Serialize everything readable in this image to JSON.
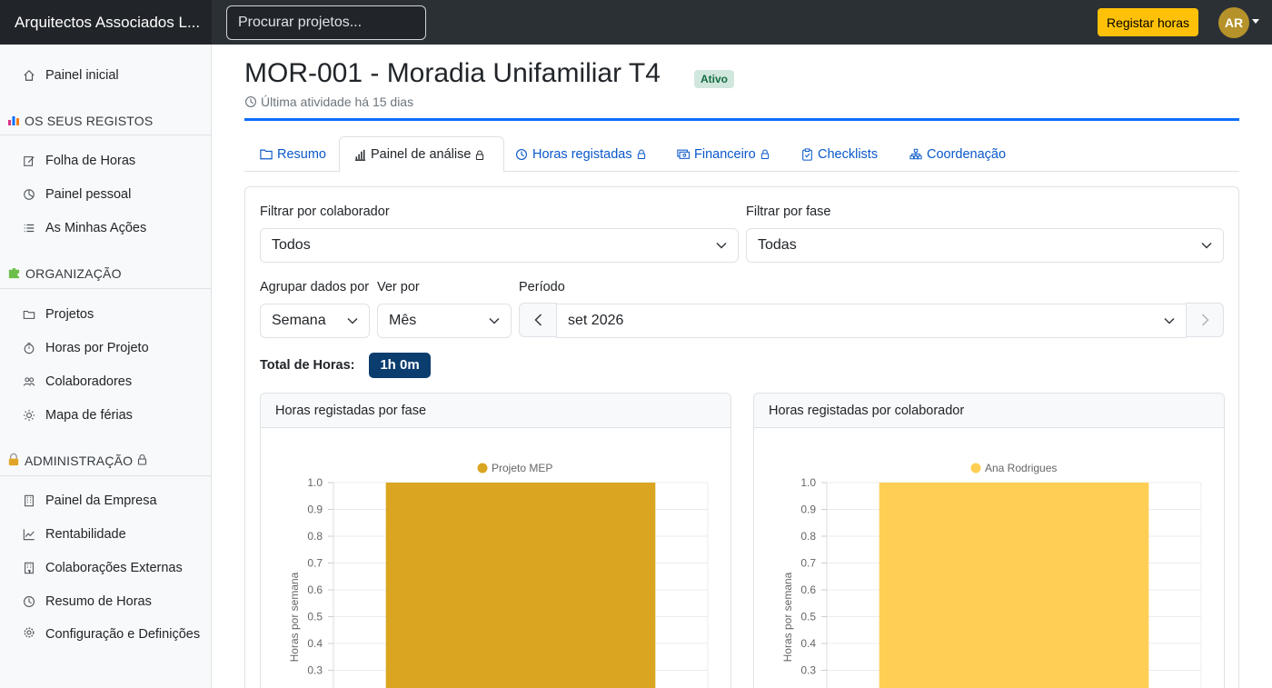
{
  "app": {
    "brand": "Arquitectos Associados L...",
    "search_placeholder": "Procurar projetos...",
    "register_hours_label": "Registar horas",
    "avatar_initials": "AR"
  },
  "sidebar": {
    "home": "Painel inicial",
    "section_records": "OS SEUS REGISTOS",
    "records": [
      "Folha de Horas",
      "Painel pessoal",
      "As Minhas Ações"
    ],
    "section_org": "ORGANIZAÇÃO",
    "org": [
      "Projetos",
      "Horas por Projeto",
      "Colaboradores",
      "Mapa de férias"
    ],
    "section_admin": "ADMINISTRAÇÃO",
    "admin": [
      "Painel da Empresa",
      "Rentabilidade",
      "Colaborações Externas",
      "Resumo de Horas",
      "Configuração e Definições"
    ]
  },
  "project": {
    "title": "MOR-001 - Moradia Unifamiliar T4",
    "status": "Ativo",
    "last_activity": "Última atividade há 15 dias"
  },
  "tabs": [
    "Resumo",
    "Painel de análise",
    "Horas registadas",
    "Financeiro",
    "Checklists",
    "Coordenação"
  ],
  "filters": {
    "collaborator_label": "Filtrar por colaborador",
    "collaborator_value": "Todos",
    "phase_label": "Filtrar por fase",
    "phase_value": "Todas",
    "group_label": "Agrupar dados por",
    "group_value": "Semana",
    "view_label": "Ver por",
    "view_value": "Mês",
    "period_label": "Período",
    "period_value": "set 2026"
  },
  "total": {
    "label": "Total de Horas:",
    "value": "1h 0m"
  },
  "colors": {
    "phase_bar": "#daa520",
    "collab_bar": "#ffce54",
    "accent": "#0d6efd"
  },
  "chart_data": [
    {
      "type": "bar",
      "title": "Horas registadas por fase",
      "ylabel": "Horas por semana",
      "ylim": [
        0,
        1.0
      ],
      "yticks": [
        "1.0",
        "0.9",
        "0.8",
        "0.7",
        "0.6",
        "0.5",
        "0.4",
        "0.3"
      ],
      "categories": [
        ""
      ],
      "series": [
        {
          "name": "Projeto MEP",
          "values": [
            1.0
          ]
        }
      ],
      "legend": "top"
    },
    {
      "type": "bar",
      "title": "Horas registadas por colaborador",
      "ylabel": "Horas por semana",
      "ylim": [
        0,
        1.0
      ],
      "yticks": [
        "1.0",
        "0.9",
        "0.8",
        "0.7",
        "0.6",
        "0.5",
        "0.4",
        "0.3"
      ],
      "categories": [
        ""
      ],
      "series": [
        {
          "name": "Ana Rodrigues",
          "values": [
            1.0
          ]
        }
      ],
      "legend": "top"
    }
  ]
}
